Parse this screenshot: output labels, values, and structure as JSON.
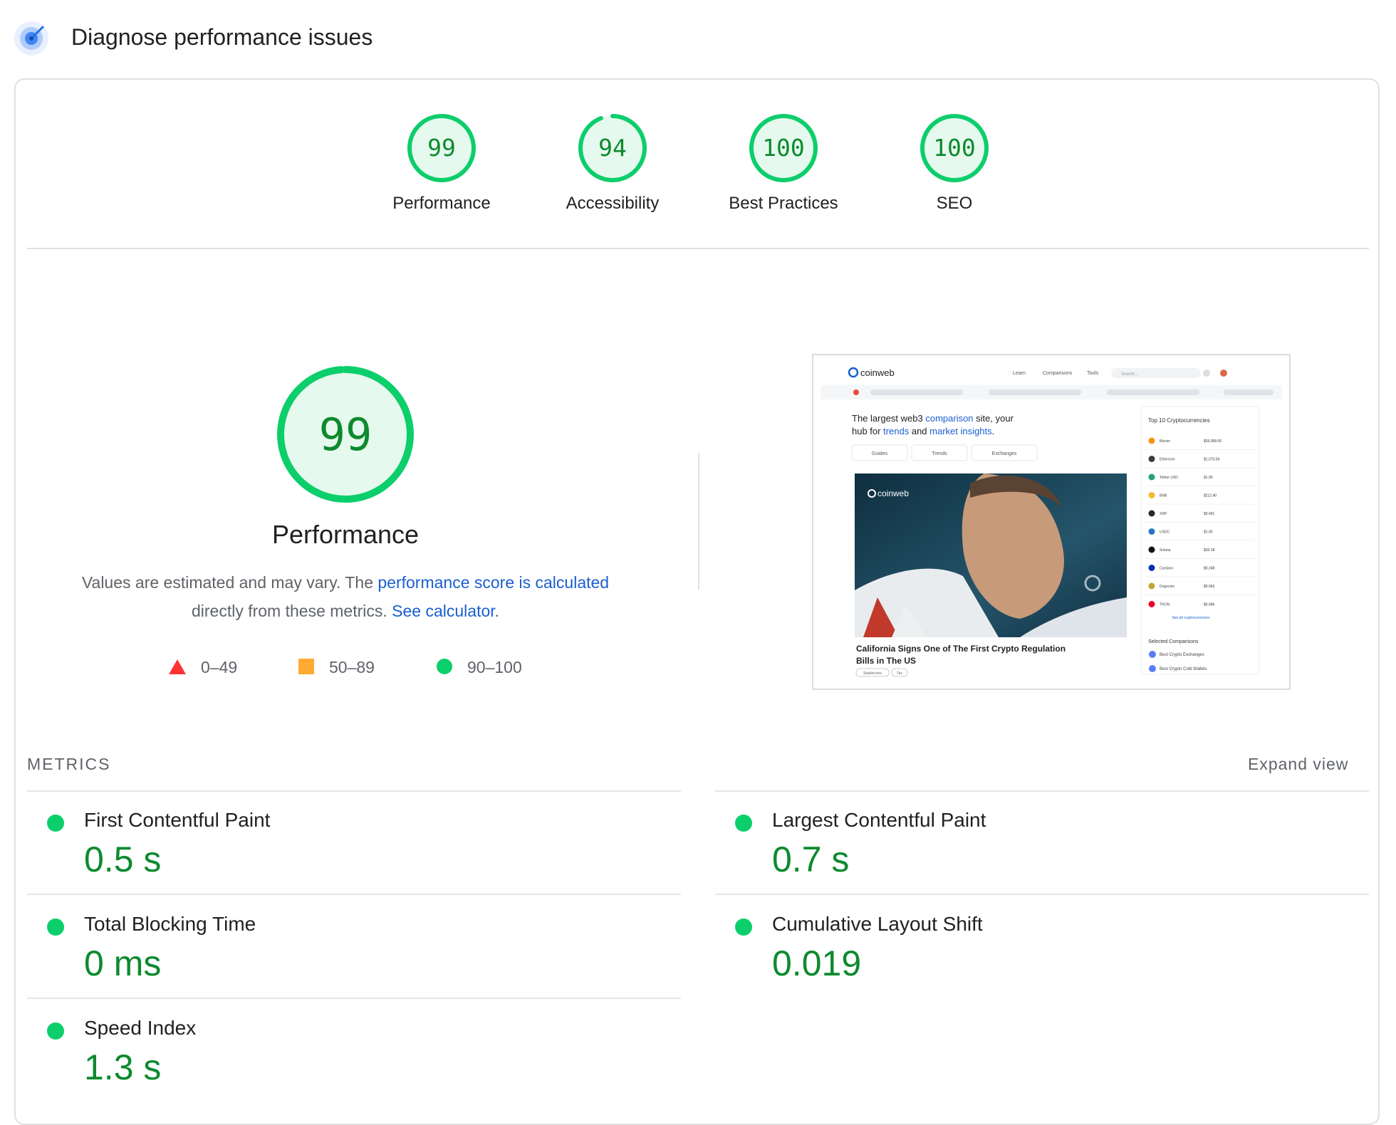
{
  "header": {
    "title": "Diagnose performance issues",
    "logo_icon": "lighthouse-icon"
  },
  "gauges": [
    {
      "score": "99",
      "value": 99,
      "label": "Performance"
    },
    {
      "score": "94",
      "value": 94,
      "label": "Accessibility"
    },
    {
      "score": "100",
      "value": 100,
      "label": "Best Practices"
    },
    {
      "score": "100",
      "value": 100,
      "label": "SEO"
    }
  ],
  "performance": {
    "score": "99",
    "value": 99,
    "title": "Performance",
    "desc_pre": "Values are estimated and may vary. The ",
    "desc_link1": "performance score is calculated",
    "desc_mid": "directly from these metrics. ",
    "desc_link2": "See calculator",
    "desc_post": "."
  },
  "legend": [
    {
      "range": "0–49",
      "shape": "triangle",
      "color": "#ff3333"
    },
    {
      "range": "50–89",
      "shape": "square",
      "color": "#ffaa33"
    },
    {
      "range": "90–100",
      "shape": "circle",
      "color": "#0cce6b"
    }
  ],
  "colors": {
    "pass": "#0cce6b",
    "pass_text": "#0d8a2e",
    "pass_bg": "#e6f9ee",
    "link": "#1a5fd0"
  },
  "screenshot": {
    "brand": "coinweb",
    "nav": [
      "Learn",
      "Comparisons",
      "Tools"
    ],
    "search_placeholder": "Search...",
    "hero_line1_pre": "The largest web3 ",
    "hero_link1": "comparison",
    "hero_line1_post": " site, your",
    "hero_line2_pre": "hub for ",
    "hero_link2": "trends",
    "hero_line2_mid": " and ",
    "hero_link3": "market insights",
    "hero_line2_post": ".",
    "buttons": [
      "Guides",
      "Trends",
      "Exchanges"
    ],
    "article_brand": "coinweb",
    "article_title_1": "California Signs One of The First Crypto Regulation",
    "article_title_2": "Bills in The US",
    "tags": [
      "Stablecoins",
      "Tax"
    ],
    "top_title": "Top 10 Cryptocurrencies",
    "coins": [
      {
        "name": "Bitcoin",
        "price": "$26,068.00",
        "color": "#f7931a"
      },
      {
        "name": "Ethereum",
        "price": "$1,570.04",
        "color": "#3c3c3d"
      },
      {
        "name": "Tether USD",
        "price": "$1.00",
        "color": "#26a17b"
      },
      {
        "name": "BNB",
        "price": "$212.40",
        "color": "#f3ba2f"
      },
      {
        "name": "XRP",
        "price": "$0.491",
        "color": "#23292f"
      },
      {
        "name": "USDC",
        "price": "$1.00",
        "color": "#2775ca"
      },
      {
        "name": "Solana",
        "price": "$20.18",
        "color": "#111111"
      },
      {
        "name": "Cardano",
        "price": "$0.248",
        "color": "#0033ad"
      },
      {
        "name": "Dogecoin",
        "price": "$0.063",
        "color": "#c2a633"
      },
      {
        "name": "TRON",
        "price": "$0.086",
        "color": "#ef0027"
      }
    ],
    "see_all": "See all cryptocurrencies",
    "comparisons_title": "Selected Comparisons",
    "comparisons": [
      "Best Crypto Exchanges",
      "Best Crypto Cold Wallets"
    ]
  },
  "metrics": {
    "heading": "METRICS",
    "expand": "Expand view",
    "items": [
      {
        "label": "First Contentful Paint",
        "value": "0.5 s"
      },
      {
        "label": "Largest Contentful Paint",
        "value": "0.7 s"
      },
      {
        "label": "Total Blocking Time",
        "value": "0 ms"
      },
      {
        "label": "Cumulative Layout Shift",
        "value": "0.019"
      },
      {
        "label": "Speed Index",
        "value": "1.3 s"
      }
    ]
  }
}
